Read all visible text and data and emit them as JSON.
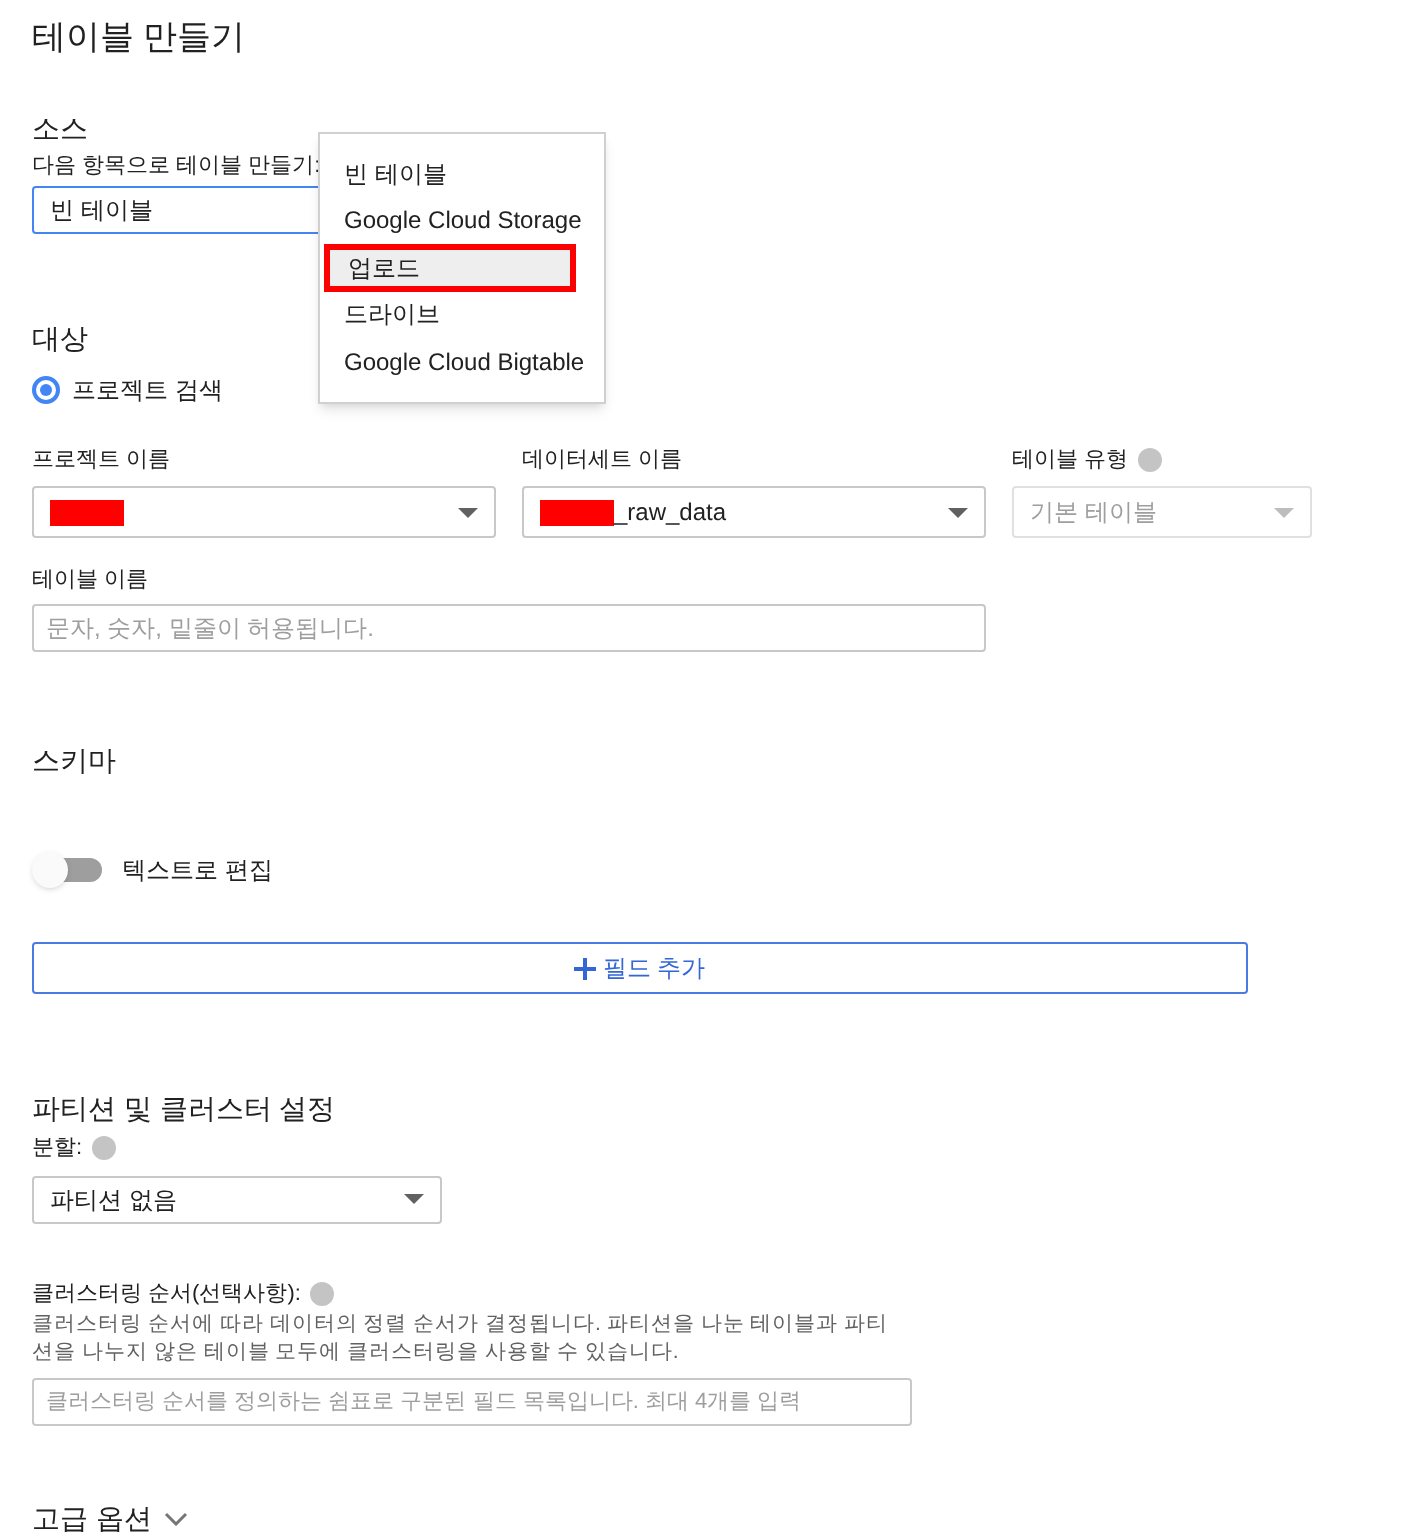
{
  "title": "테이블 만들기",
  "source": {
    "heading": "소스",
    "label": "다음 항목으로 테이블 만들기:",
    "value": "빈 테이블",
    "menu": [
      {
        "label": "빈 테이블",
        "highlighted": false
      },
      {
        "label": "Google Cloud Storage",
        "highlighted": false
      },
      {
        "label": "업로드",
        "highlighted": true
      },
      {
        "label": "드라이브",
        "highlighted": false
      },
      {
        "label": "Google Cloud Bigtable",
        "highlighted": false
      }
    ]
  },
  "destination": {
    "heading": "대상",
    "radio": {
      "label": "프로젝트 검색",
      "selected": true
    },
    "fields": [
      {
        "label": "프로젝트 이름",
        "redacted": true,
        "disabled": false
      },
      {
        "label": "데이터세트 이름",
        "value": "_raw_data",
        "redacted": true,
        "disabled": false
      },
      {
        "label": "테이블 유형",
        "value": "기본 테이블",
        "redacted": false,
        "disabled": true,
        "help": true
      }
    ],
    "table_name": {
      "label": "테이블 이름",
      "placeholder": "문자, 숫자, 밑줄이 허용됩니다."
    }
  },
  "schema": {
    "heading": "스키마",
    "toggle": {
      "label": "텍스트로 편집",
      "on": false
    },
    "add_button": "필드 추가"
  },
  "partition": {
    "heading": "파티션 및 클러스터 설정",
    "label": "분할:",
    "value": "파티션 없음",
    "clustering_label": "클러스터링 순서(선택사항):",
    "clustering_description": "클러스터링 순서에 따라 데이터의 정렬 순서가 결정됩니다. 파티션을 나눈 테이블과 파티션을 나누지 않은 테이블 모두에 클러스터링을 사용할 수 있습니다.",
    "clustering_placeholder": "클러스터링 순서를 정의하는 쉼표로 구분된 필드 목록입니다. 최대 4개를 입력"
  },
  "advanced": {
    "label": "고급 옵션",
    "expanded": false
  }
}
